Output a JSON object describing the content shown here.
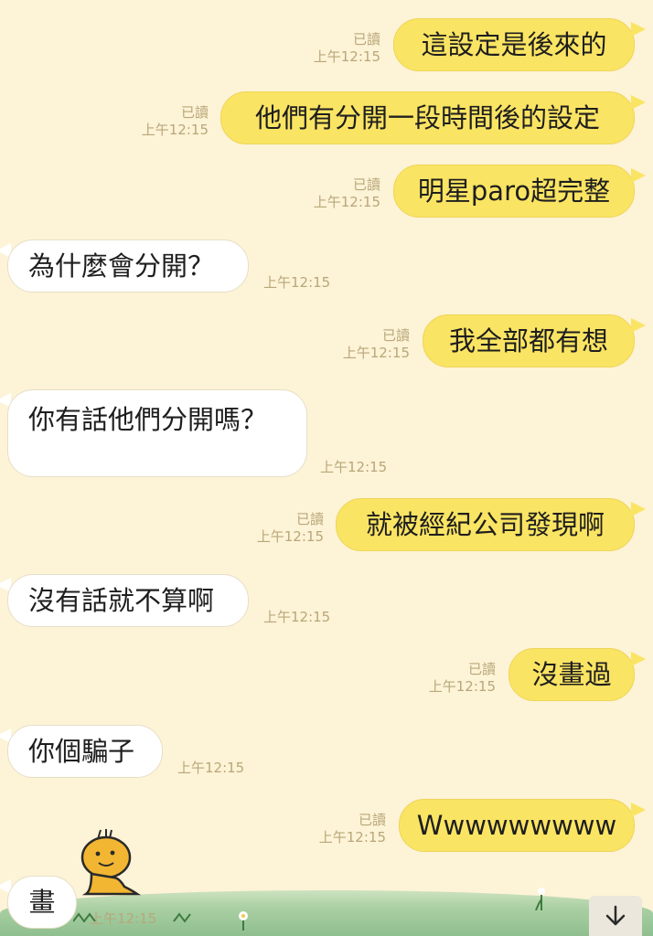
{
  "chat": {
    "read_label": "已讀",
    "messages": [
      {
        "side": "me",
        "text": "這設定是後來的",
        "time": "上午12:15",
        "read": true
      },
      {
        "side": "me",
        "text": "他們有分開一段時間後的設定",
        "time": "上午12:15",
        "read": true
      },
      {
        "side": "me",
        "text": "明星paro超完整",
        "time": "上午12:15",
        "read": true
      },
      {
        "side": "them",
        "text": "為什麼會分開？",
        "time": "上午12:15"
      },
      {
        "side": "me",
        "text": "我全部都有想",
        "time": "上午12:15",
        "read": true
      },
      {
        "side": "them",
        "text": "你有話他們分開嗎？",
        "time": "上午12:15"
      },
      {
        "side": "me",
        "text": "就被經紀公司發現啊",
        "time": "上午12:15",
        "read": true
      },
      {
        "side": "them",
        "text": "沒有話就不算啊",
        "time": "上午12:15"
      },
      {
        "side": "me",
        "text": "沒畫過",
        "time": "上午12:15",
        "read": true
      },
      {
        "side": "them",
        "text": "你個騙子",
        "time": "上午12:15"
      },
      {
        "side": "me",
        "text": "Wwwwwwwww",
        "time": "上午12:15",
        "read": true
      },
      {
        "side": "them",
        "text": "畫",
        "time": "上午12:15"
      }
    ]
  },
  "icons": {
    "scroll_down": "arrow-down-icon",
    "mascot": "yellow-bird-sticker"
  },
  "colors": {
    "background": "#fdf3d6",
    "my_bubble": "#fae463",
    "their_bubble": "#ffffff",
    "meta_text": "#b8a77a"
  }
}
